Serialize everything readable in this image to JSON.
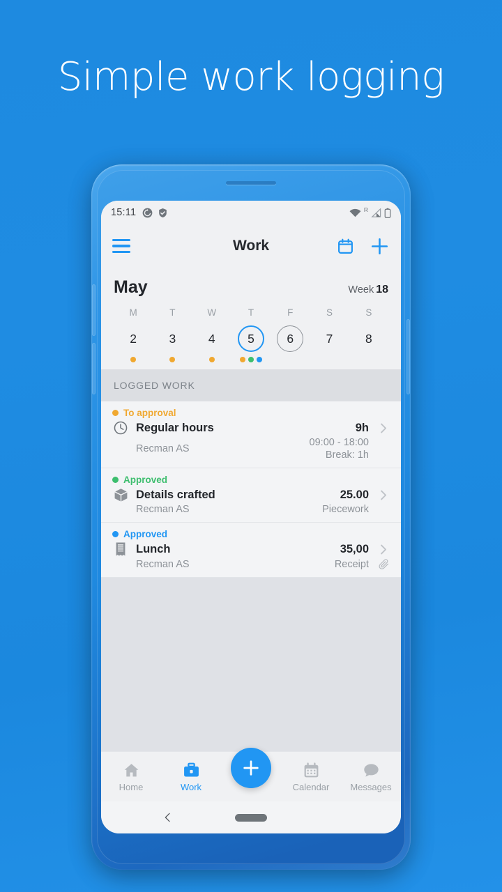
{
  "headline": "Simple work logging",
  "colors": {
    "background": "#1f8ce2",
    "accent": "#2196f3",
    "pending": "#f0a830",
    "approved_green": "#3dbe6e",
    "approved_blue": "#2196f3"
  },
  "status_bar": {
    "time": "15:11",
    "left_icons": [
      "sync-icon",
      "shield-check-icon"
    ],
    "right_icons": [
      "wifi-icon",
      "roaming-signal-icon",
      "battery-icon"
    ]
  },
  "app_bar": {
    "menu_icon": "hamburger-menu-icon",
    "title": "Work",
    "calendar_icon": "calendar-icon",
    "add_icon": "plus-icon"
  },
  "calendar": {
    "month": "May",
    "week_label": "Week",
    "week_number": "18",
    "days": [
      {
        "dow": "M",
        "num": "2",
        "state": "normal",
        "dots": [
          "#f0a830"
        ]
      },
      {
        "dow": "T",
        "num": "3",
        "state": "normal",
        "dots": [
          "#f0a830"
        ]
      },
      {
        "dow": "W",
        "num": "4",
        "state": "normal",
        "dots": [
          "#f0a830"
        ]
      },
      {
        "dow": "T",
        "num": "5",
        "state": "today",
        "dots": [
          "#f0a830",
          "#3dbe6e",
          "#2196f3"
        ]
      },
      {
        "dow": "F",
        "num": "6",
        "state": "marked",
        "dots": []
      },
      {
        "dow": "S",
        "num": "7",
        "state": "normal",
        "dots": []
      },
      {
        "dow": "S",
        "num": "8",
        "state": "normal",
        "dots": []
      }
    ]
  },
  "section_header": "LOGGED WORK",
  "entries": [
    {
      "status": "To approval",
      "status_color": "#f0a830",
      "icon": "clock-icon",
      "title": "Regular hours",
      "amount": "9h",
      "company": "Recman AS",
      "detail_1": "09:00 - 18:00",
      "detail_2": "Break: 1h",
      "attachment": false
    },
    {
      "status": "Approved",
      "status_color": "#3dbe6e",
      "icon": "box-icon",
      "title": "Details crafted",
      "amount": "25.00",
      "company": "Recman AS",
      "detail_1": "Piecework",
      "detail_2": "",
      "attachment": false
    },
    {
      "status": "Approved",
      "status_color": "#2196f3",
      "icon": "receipt-icon",
      "title": "Lunch",
      "amount": "35,00",
      "company": "Recman AS",
      "detail_1": "Receipt",
      "detail_2": "",
      "attachment": true
    }
  ],
  "bottom_nav": {
    "items": [
      {
        "label": "Home",
        "icon": "home-icon",
        "active": false
      },
      {
        "label": "Work",
        "icon": "briefcase-icon",
        "active": true
      },
      {
        "label": "Calendar",
        "icon": "calendar-icon",
        "active": false
      },
      {
        "label": "Messages",
        "icon": "chat-bubble-icon",
        "active": false
      }
    ],
    "fab_icon": "plus-icon"
  },
  "android_nav": {
    "back_icon": "back-chevron-icon",
    "home_pill": "home-pill-handle"
  }
}
